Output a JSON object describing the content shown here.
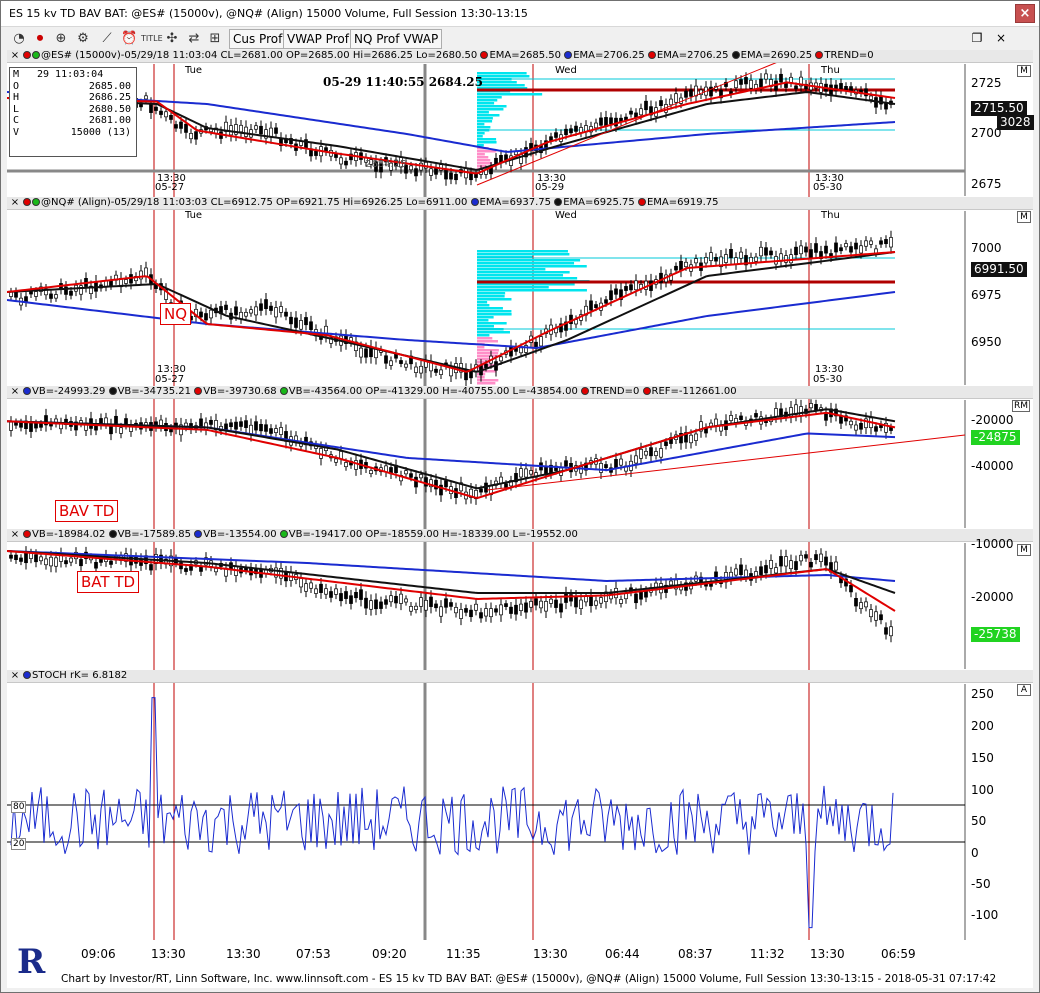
{
  "window": {
    "title": "ES 15  kv TD BAV BAT: @ES# (15000v), @NQ# (Align) 15000 Volume, Full Session 13:30-13:15",
    "close_label": "×"
  },
  "toolbar": {
    "icons": [
      "chart-icon",
      "record-icon",
      "zoom-icon",
      "gear-icon",
      "draw-icon",
      "clock-icon",
      "title-icon",
      "move-icon",
      "scale-icon",
      "grid-icon"
    ],
    "title_label": "TITLE",
    "buttons": [
      "Cus Prof",
      "VWAP Prof",
      "NQ Prof VWAP"
    ],
    "restore_label": "❐",
    "x_label": "×"
  },
  "ohlc": {
    "date": "29 11:03:04",
    "rows": [
      {
        "k": "M",
        "v": ""
      },
      {
        "k": "O",
        "v": "2685.00"
      },
      {
        "k": "H",
        "v": "2686.25"
      },
      {
        "k": "L",
        "v": "2680.50"
      },
      {
        "k": "C",
        "v": "2681.00"
      },
      {
        "k": "V",
        "v": "15000 (13)"
      }
    ]
  },
  "panes": {
    "es": {
      "legend": [
        "@ES# (15000v)-05/29/18 11:03:04 CL=2681.00 OP=2685.00 Hi=2686.25 Lo=2680.50",
        "EMA=2685.50",
        "EMA=2706.25",
        "EMA=2706.25",
        "EMA=2690.25",
        "TREND=0"
      ],
      "ticks": [
        "2725",
        "2700",
        "2675"
      ],
      "price_tag": "2715.50",
      "count_tag": "3028",
      "tag": "M",
      "cursor_label": "05-29 11:40:55  2684.25",
      "day_labels": [
        "Tue",
        "Wed",
        "Thu"
      ],
      "time_marks": [
        "13:30",
        "05-27",
        "13:30",
        "05-29",
        "13:30",
        "05-30"
      ],
      "inner_text": "2684.25"
    },
    "nq": {
      "legend": [
        "@NQ# (Align)-05/29/18 11:03:03 CL=6912.75 OP=6921.75 Hi=6926.25 Lo=6911.00",
        "EMA=6937.75",
        "EMA=6925.75",
        "EMA=6919.75"
      ],
      "ticks": [
        "7000",
        "6975",
        "6950"
      ],
      "price_tag": "6991.50",
      "tag": "M",
      "label": "NQ",
      "day_labels": [
        "Tue",
        "Wed",
        "Thu"
      ],
      "time_marks": [
        "13:30",
        "05-27",
        "13:30",
        "05-29",
        "13:30",
        "05-30"
      ]
    },
    "bav": {
      "legend": [
        "VB=-24993.29",
        "VB=-34735.21",
        "VB=-39730.68",
        "VB=-43564.00 OP=-41329.00 H=-40755.00 L=-43854.00",
        "TREND=0",
        "REF=-112661.00"
      ],
      "ticks": [
        "-20000",
        "-40000"
      ],
      "value_tag": "-24875",
      "tag": "RM",
      "label": "BAV TD"
    },
    "bat": {
      "legend": [
        "VB=-18984.02",
        "VB=-17589.85",
        "VB=-13554.00",
        "VB=-19417.00 OP=-18559.00 H=-18339.00 L=-19552.00"
      ],
      "ticks": [
        "-10000",
        "-20000"
      ],
      "value_tag": "-25738",
      "tag": "M",
      "label": "BAT TD"
    },
    "stoch": {
      "legend": [
        "STOCH rK=  6.8182"
      ],
      "ticks": [
        "250",
        "200",
        "150",
        "100",
        "50",
        "0",
        "-50",
        "-100"
      ],
      "tag": "A",
      "level_labels": [
        "80",
        "20"
      ]
    }
  },
  "xaxis": [
    "09:06",
    "13:30",
    "13:30",
    "07:53",
    "09:20",
    "11:35",
    "13:30",
    "06:44",
    "08:37",
    "11:32",
    "13:30",
    "06:59"
  ],
  "footer": "Chart by Investor/RT, Linn Software, Inc. www.linnsoft.com - ES 15  kv TD BAV BAT: @ES# (15000v), @NQ# (Align) 15000 Volume, Full Session 13:30-13:15 - 2018-05-31 07:17:42",
  "logo_letter": "R",
  "colors": {
    "ema_red": "#e00000",
    "ema_black": "#111111",
    "ema_blue": "#1a2bd0",
    "profile_cyan": "#00e5ee",
    "profile_pink": "#ff8ec8",
    "level_red": "#b00000",
    "tag_green": "#21d321"
  }
}
